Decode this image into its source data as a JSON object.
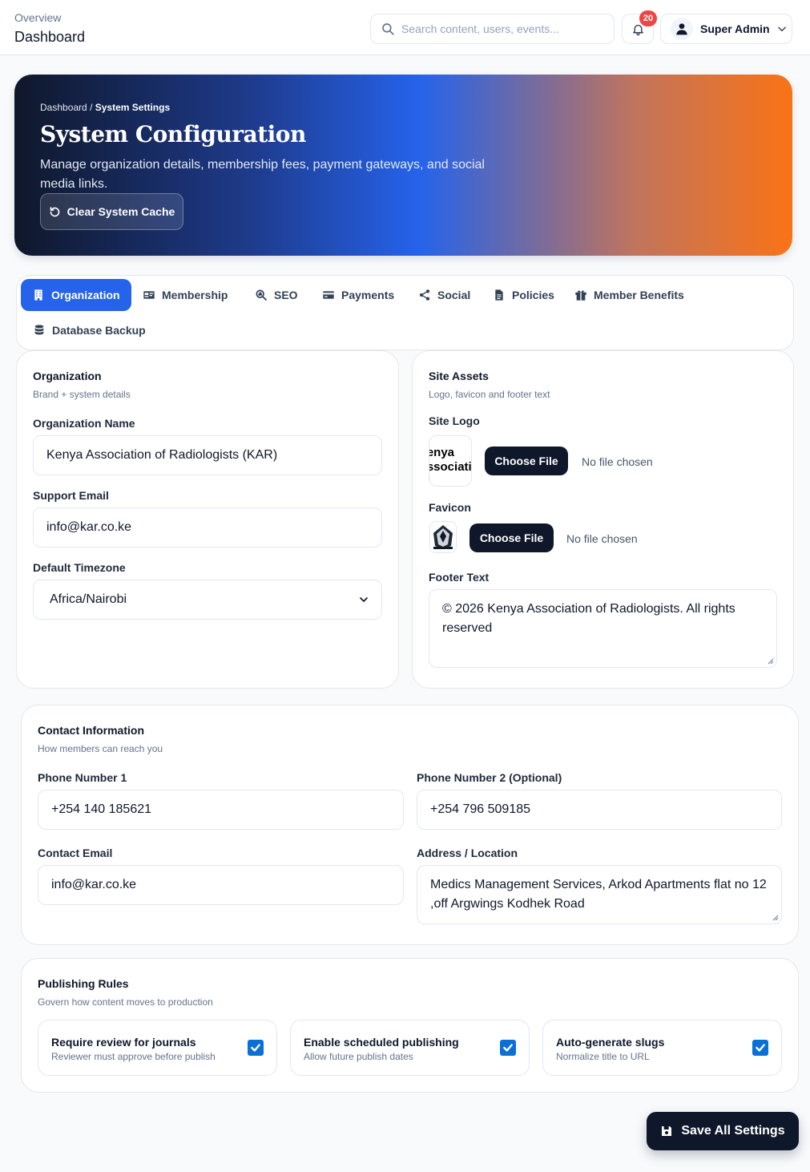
{
  "header": {
    "overline": "Overview",
    "title": "Dashboard",
    "search_placeholder": "Search content, users, events...",
    "notification_count": "20",
    "user_name": "Super Admin"
  },
  "hero": {
    "breadcrumb_root": "Dashboard",
    "breadcrumb_sep": "/",
    "breadcrumb_current": "System Settings",
    "title": "System Configuration",
    "description": "Manage organization details, membership fees, payment gateways, and social media links.",
    "cache_button": "Clear System Cache"
  },
  "tabs": [
    {
      "label": "Organization",
      "icon": "building-icon",
      "active": true
    },
    {
      "label": "Membership",
      "icon": "id-card-icon",
      "active": false
    },
    {
      "label": "SEO",
      "icon": "search-chart-icon",
      "active": false
    },
    {
      "label": "Payments",
      "icon": "credit-card-icon",
      "active": false
    },
    {
      "label": "Social",
      "icon": "share-icon",
      "active": false
    },
    {
      "label": "Policies",
      "icon": "file-icon",
      "active": false
    },
    {
      "label": "Member Benefits",
      "icon": "gift-icon",
      "active": false
    },
    {
      "label": "Database Backup",
      "icon": "database-icon",
      "active": false
    }
  ],
  "organization": {
    "title": "Organization",
    "subtitle": "Brand + system details",
    "name_label": "Organization Name",
    "name_value": "Kenya Association of Radiologists (KAR)",
    "email_label": "Support Email",
    "email_value": "info@kar.co.ke",
    "timezone_label": "Default Timezone",
    "timezone_value": "Africa/Nairobi"
  },
  "site_assets": {
    "title": "Site Assets",
    "subtitle": "Logo, favicon and footer text",
    "logo_label": "Site Logo",
    "logo_text": "Kenya Association of Radiologists",
    "choose_label": "Choose File",
    "no_file": "No file chosen",
    "favicon_label": "Favicon",
    "footer_label": "Footer Text",
    "footer_value": "© 2026 Kenya Association of Radiologists. All rights reserved"
  },
  "contact": {
    "title": "Contact Information",
    "subtitle": "How members can reach you",
    "phone1_label": "Phone Number 1",
    "phone1_value": "+254 140 185621",
    "phone2_label": "Phone Number 2 (Optional)",
    "phone2_value": "+254 796 509185",
    "email_label": "Contact Email",
    "email_value": "info@kar.co.ke",
    "address_label": "Address / Location",
    "address_value": "Medics Management Services, Arkod Apartments flat no 12 ,off Argwings Kodhek Road"
  },
  "publishing": {
    "title": "Publishing Rules",
    "subtitle": "Govern how content moves to production",
    "rules": [
      {
        "title": "Require review for journals",
        "sub": "Reviewer must approve before publish",
        "checked": true
      },
      {
        "title": "Enable scheduled publishing",
        "sub": "Allow future publish dates",
        "checked": true
      },
      {
        "title": "Auto-generate slugs",
        "sub": "Normalize title to URL",
        "checked": true
      }
    ]
  },
  "save_button": "Save All Settings",
  "colors": {
    "primary": "#2563eb",
    "dark": "#0f172a",
    "badge": "#ef4444",
    "checkbox": "#0b6fd8",
    "hero_end": "#f97316"
  }
}
